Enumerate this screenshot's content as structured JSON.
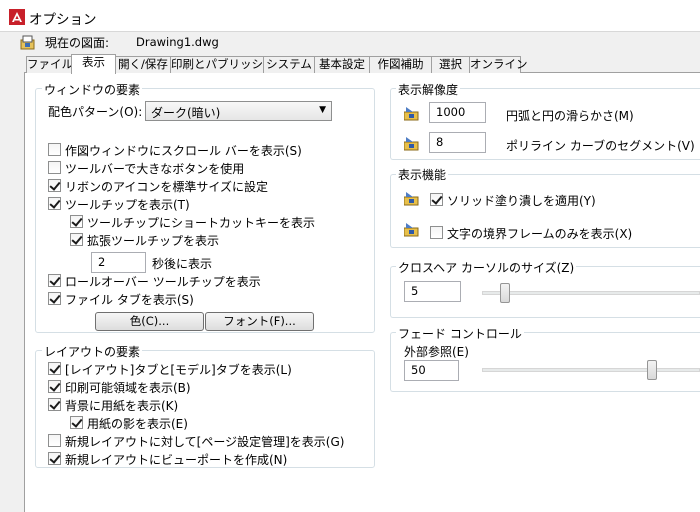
{
  "window": {
    "title": "オプション"
  },
  "drawing": {
    "label": "現在の図面:",
    "name": "Drawing1.dwg"
  },
  "tabs": [
    {
      "label": "ファイル"
    },
    {
      "label": "表示"
    },
    {
      "label": "開く/保存"
    },
    {
      "label": "印刷とパブリッシュ"
    },
    {
      "label": "システム"
    },
    {
      "label": "基本設定"
    },
    {
      "label": "作図補助"
    },
    {
      "label": "選択"
    },
    {
      "label": "オンライン"
    }
  ],
  "window_elements": {
    "title": "ウィンドウの要素",
    "color_scheme_label": "配色パターン(O):",
    "color_scheme_value": "ダーク(暗い)",
    "checkboxes": [
      {
        "label": "作図ウィンドウにスクロール バーを表示(S)",
        "checked": false
      },
      {
        "label": "ツールバーで大きなボタンを使用",
        "checked": false
      },
      {
        "label": "リボンのアイコンを標準サイズに設定",
        "checked": true
      },
      {
        "label": "ツールチップを表示(T)",
        "checked": true
      },
      {
        "label": "ツールチップにショートカットキーを表示",
        "checked": true
      },
      {
        "label": "拡張ツールチップを表示",
        "checked": true
      },
      {
        "label": "ロールオーバー ツールチップを表示",
        "checked": true
      },
      {
        "label": "ファイル タブを表示(S)",
        "checked": true
      }
    ],
    "delay_value": "2",
    "delay_label": "秒後に表示",
    "color_button": "色(C)...",
    "font_button": "フォント(F)..."
  },
  "layout_elements": {
    "title": "レイアウトの要素",
    "checkboxes": [
      {
        "label": "[レイアウト]タブと[モデル]タブを表示(L)",
        "checked": true
      },
      {
        "label": "印刷可能領域を表示(B)",
        "checked": true
      },
      {
        "label": "背景に用紙を表示(K)",
        "checked": true
      },
      {
        "label": "用紙の影を表示(E)",
        "checked": true
      },
      {
        "label": "新規レイアウトに対して[ページ設定管理]を表示(G)",
        "checked": false
      },
      {
        "label": "新規レイアウトにビューポートを作成(N)",
        "checked": true
      }
    ]
  },
  "display_resolution": {
    "title": "表示解像度",
    "arc_value": "1000",
    "arc_label": "円弧と円の滑らかさ(M)",
    "polyline_value": "8",
    "polyline_label": "ポリライン カーブのセグメント(V)"
  },
  "display_performance": {
    "title": "表示機能",
    "checkboxes": [
      {
        "label": "ソリッド塗り潰しを適用(Y)",
        "checked": true
      },
      {
        "label": "文字の境界フレームのみを表示(X)",
        "checked": false
      }
    ]
  },
  "crosshair": {
    "title": "クロスヘア カーソルのサイズ(Z)",
    "value": "5",
    "level": 5
  },
  "fade": {
    "title": "フェード コントロール",
    "xref_label": "外部参照(E)",
    "value": "50",
    "level": 50
  },
  "colors": {
    "tab_border": "#a0a0a0",
    "group_border": "#d5dfe5",
    "app_icon_red": "#c8202a"
  }
}
